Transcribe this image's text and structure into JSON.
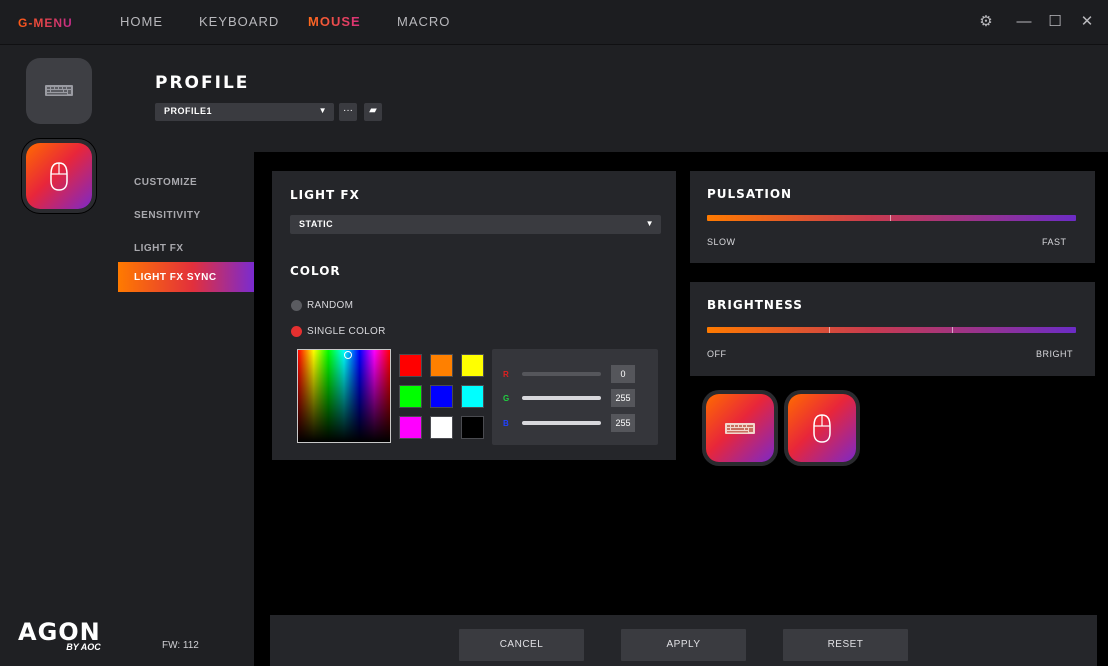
{
  "app": {
    "logo": "G-MENU",
    "nav": [
      {
        "label": "HOME"
      },
      {
        "label": "KEYBOARD"
      },
      {
        "label": "MOUSE",
        "active": true
      },
      {
        "label": "MACRO"
      }
    ],
    "window_controls": {
      "settings": "⚙",
      "minimize": "—",
      "maximize": "☐",
      "close": "✕"
    }
  },
  "rail": {
    "devices": [
      {
        "name": "keyboard-icon"
      },
      {
        "name": "mouse-icon",
        "active": true
      }
    ],
    "brand_main": "AGON",
    "brand_sub": "BY AOC"
  },
  "profile": {
    "title": "PROFILE",
    "selected": "PROFILE1",
    "more_label": "···",
    "folder_label": "▰"
  },
  "subnav": {
    "items": [
      {
        "label": "CUSTOMIZE"
      },
      {
        "label": "SENSITIVITY"
      },
      {
        "label": "LIGHT FX"
      },
      {
        "label": "LIGHT FX SYNC",
        "active": true
      }
    ],
    "fw": "FW: 112"
  },
  "light_fx": {
    "title": "LIGHT FX",
    "effect": "STATIC",
    "color_title": "COLOR",
    "options": [
      {
        "label": "RANDOM",
        "selected": false
      },
      {
        "label": "SINGLE COLOR",
        "selected": true
      }
    ],
    "swatches": [
      "#ff0000",
      "#ff8000",
      "#ffff00",
      "#00ff00",
      "#0000ff",
      "#00ffff",
      "#ff00ff",
      "#ffffff",
      "#000000"
    ],
    "rgb": {
      "r": {
        "letter": "R",
        "value": "0",
        "color": "#e02020"
      },
      "g": {
        "letter": "G",
        "value": "255",
        "color": "#20d040"
      },
      "b": {
        "letter": "B",
        "value": "255",
        "color": "#2040ff"
      }
    }
  },
  "pulsation": {
    "title": "PULSATION",
    "min_label": "SLOW",
    "max_label": "FAST",
    "level": 1.0
  },
  "brightness": {
    "title": "BRIGHTNESS",
    "min_label": "OFF",
    "max_label": "BRIGHT",
    "level": 1.0
  },
  "footer": {
    "cancel": "CANCEL",
    "apply": "APPLY",
    "reset": "RESET"
  }
}
